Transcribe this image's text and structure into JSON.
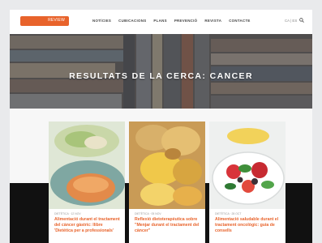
{
  "header": {
    "logo_text": "REVIEW",
    "nav": [
      "NOTÍCIES",
      "CUBICACIONS",
      "PLANS",
      "PREVENCIÓ",
      "REVISTA",
      "CONTACTE"
    ],
    "lang": "CA | ES"
  },
  "hero": {
    "title": "RESULTATS DE LA CERCA: CANCER"
  },
  "results": [
    {
      "meta": "DIETÈTICA · 12 NOV",
      "title": "Alimentació durant el tractament del càncer gàstric: llibre 'Dietètica per a professionals'"
    },
    {
      "meta": "DIETÈTICA · 05 NOV",
      "title": "Reflexió dietoterapèutica sobre \"Menjar durant el tractament del càncer\""
    },
    {
      "meta": "DIETÈTICA · 28 OCT",
      "title": "Alimentació saludable durant el tractament oncològic: guia de consells"
    }
  ],
  "colors": {
    "accent": "#e8632b",
    "dark_band": "#111111"
  }
}
